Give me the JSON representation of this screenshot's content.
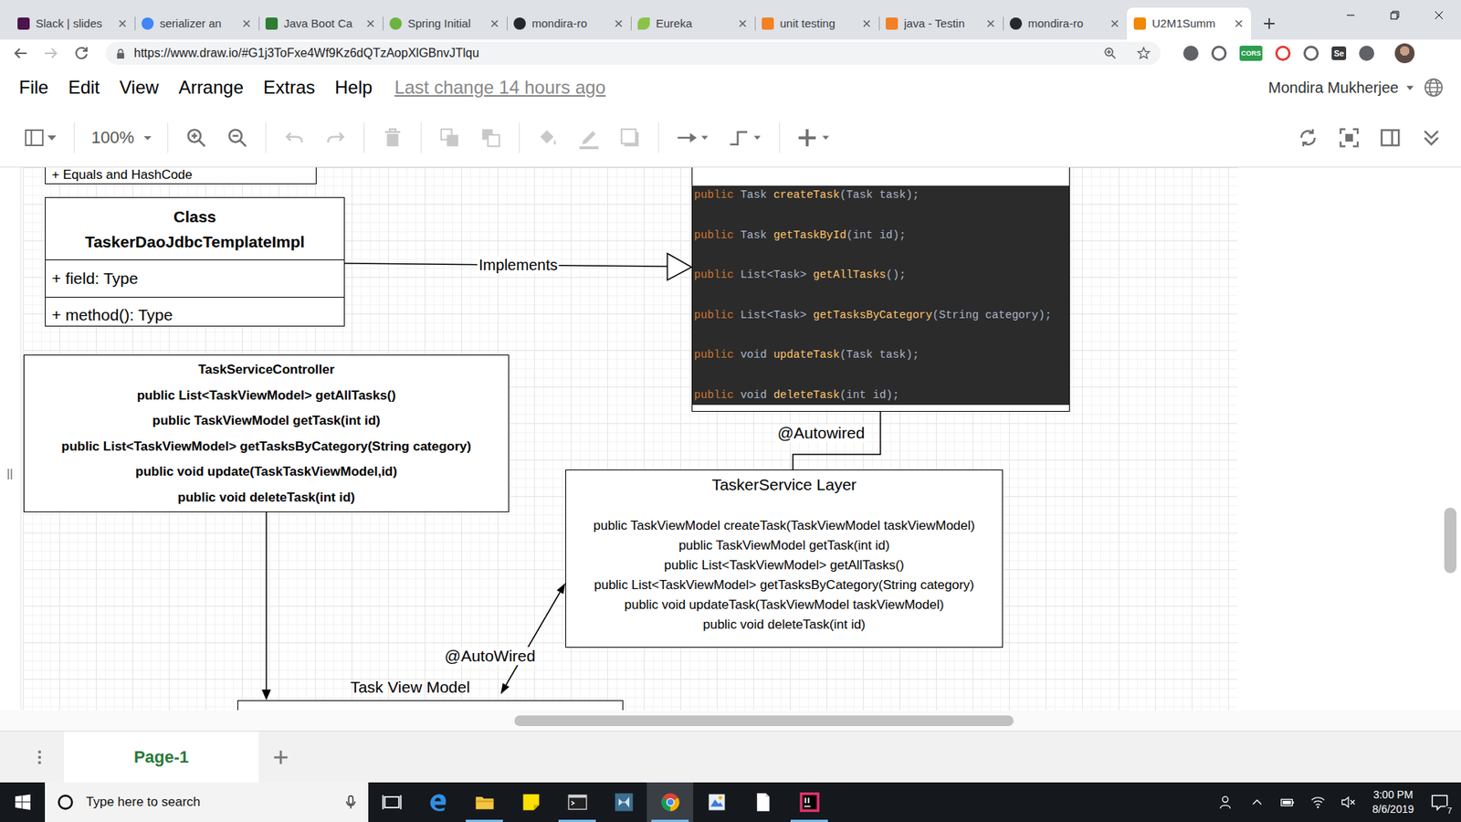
{
  "browser": {
    "tabs": [
      {
        "label": "Slack | slides",
        "selected": false
      },
      {
        "label": "serializer an",
        "selected": false
      },
      {
        "label": "Java Boot Ca",
        "selected": false
      },
      {
        "label": "Spring Initial",
        "selected": false
      },
      {
        "label": "mondira-ro",
        "selected": false
      },
      {
        "label": "Eureka",
        "selected": false
      },
      {
        "label": "unit testing",
        "selected": false
      },
      {
        "label": "java - Testin",
        "selected": false
      },
      {
        "label": "mondira-ro",
        "selected": false
      },
      {
        "label": "U2M1Summ",
        "selected": true
      }
    ],
    "url": "https://www.draw.io/#G1j3ToFxe4Wf9Kz6dQTzAopXlGBnvJTlqu",
    "extensions": [
      "CORS",
      "Se"
    ]
  },
  "menu": {
    "items": [
      "File",
      "Edit",
      "View",
      "Arrange",
      "Extras",
      "Help"
    ],
    "last_change": "Last change 14 hours ago",
    "user": "Mondira Mukherjee"
  },
  "toolbar": {
    "zoom": "100%",
    "groups": [
      [
        {
          "kind": "zoom-in",
          "disabled": false
        },
        {
          "kind": "zoom-out",
          "disabled": false
        }
      ],
      [
        {
          "kind": "undo",
          "disabled": true
        },
        {
          "kind": "redo",
          "disabled": true
        }
      ],
      [
        {
          "kind": "delete",
          "disabled": true
        }
      ],
      [
        {
          "kind": "to-front",
          "disabled": true
        },
        {
          "kind": "to-back",
          "disabled": true
        }
      ],
      [
        {
          "kind": "fill",
          "disabled": true
        },
        {
          "kind": "line",
          "disabled": true
        },
        {
          "kind": "shadow",
          "disabled": true
        }
      ],
      [
        {
          "kind": "connection",
          "disabled": false
        },
        {
          "kind": "waypoint",
          "disabled": false
        }
      ],
      [
        {
          "kind": "insert",
          "disabled": false
        }
      ]
    ]
  },
  "diagram": {
    "equals_box": "+ Equals and HashCode",
    "dao_class": {
      "title": [
        "Class",
        "TaskerDaoJdbcTemplateImpl"
      ],
      "field": "+ field: Type",
      "method": "+ method(): Type"
    },
    "implements_label": "Implements",
    "interface_code": [
      {
        "modifier": "public",
        "type": "Task",
        "name": "createTask",
        "params": "(Task task);"
      },
      {
        "modifier": "public",
        "type": "Task",
        "name": "getTaskById",
        "params": "(int id);"
      },
      {
        "modifier": "public",
        "type": "List<Task>",
        "name": "getAllTasks",
        "params": "();"
      },
      {
        "modifier": "public",
        "type": "List<Task>",
        "name": "getTasksByCategory",
        "params": "(String category);"
      },
      {
        "modifier": "public",
        "type": "void",
        "name": "updateTask",
        "params": "(Task task);"
      },
      {
        "modifier": "public",
        "type": "void",
        "name": "deleteTask",
        "params": "(int id);"
      }
    ],
    "autowired_label": "@Autowired",
    "service": {
      "title": "TaskerService Layer",
      "methods": [
        "public TaskViewModel createTask(TaskViewModel taskViewModel)",
        "public TaskViewModel getTask(int id)",
        "public List<TaskViewModel> getAllTasks()",
        "public List<TaskViewModel> getTasksByCategory(String category)",
        "public void updateTask(TaskViewModel taskViewModel)",
        "public void deleteTask(int id)"
      ]
    },
    "controller": {
      "title": "TaskServiceController",
      "methods": [
        "public List<TaskViewModel> getAllTasks()",
        "public TaskViewModel getTask(int id)",
        "public List<TaskViewModel> getTasksByCategory(String category)",
        "public void update(TaskTaskViewModel,id)",
        "public void deleteTask(int id)"
      ]
    },
    "autowired2_label": "@AutoWired",
    "view_model_label": "Task View Model"
  },
  "pages": [
    {
      "label": "Page-1",
      "selected": true
    }
  ],
  "taskbar": {
    "search_placeholder": "Type here to search",
    "apps": [
      {
        "kind": "task-view",
        "running": false,
        "selected": false
      },
      {
        "kind": "edge",
        "running": false,
        "selected": false
      },
      {
        "kind": "explorer",
        "running": true,
        "selected": false
      },
      {
        "kind": "sticky-notes",
        "running": false,
        "selected": false
      },
      {
        "kind": "terminal",
        "running": true,
        "selected": false
      },
      {
        "kind": "visual-studio",
        "running": false,
        "selected": false
      },
      {
        "kind": "chrome",
        "running": true,
        "selected": true
      },
      {
        "kind": "paint",
        "running": false,
        "selected": false
      },
      {
        "kind": "notepad",
        "running": false,
        "selected": false
      },
      {
        "kind": "intellij",
        "running": true,
        "selected": false
      }
    ],
    "time": "3:00 PM",
    "date": "8/6/2019",
    "notifications": "7"
  }
}
